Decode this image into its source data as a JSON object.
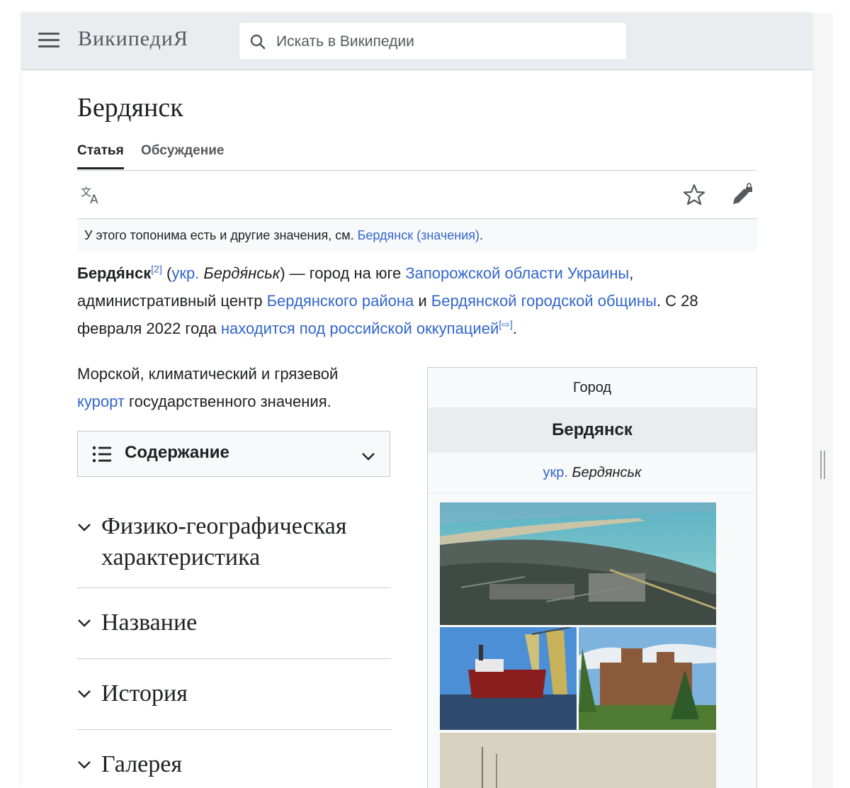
{
  "header": {
    "wordmark": "ВикипедиЯ",
    "search_placeholder": "Искать в Википедии"
  },
  "article": {
    "title": "Бердянск",
    "tabs": [
      {
        "label": "Статья",
        "active": true
      },
      {
        "label": "Обсуждение",
        "active": false
      }
    ],
    "hatnote": {
      "text": "У этого топонима есть и другие значения, см. ",
      "link": "Бердянск (значения)",
      "end": "."
    },
    "lead": {
      "bold": "Бердя́нск",
      "ref1": "[2]",
      "open_paren": " (",
      "lang": "укр.",
      "native": "Бердя́нськ",
      "t1": ") — город на юге ",
      "link1": "Запорожской области Украины",
      "t2": ", административный центр ",
      "link2": "Бердянского района",
      "t3": " и ",
      "link3": "Бердянской городской общины",
      "t4": ". С 28 февраля 2022 года ",
      "link4": "находится под российской оккупацией",
      "ref2": "[⇨]",
      "t5": "."
    },
    "second_para": {
      "t1": "Морской, климатический и грязевой ",
      "link": "курорт",
      "t2": " государственного значения."
    },
    "toc_label": "Содержание",
    "sections": [
      "Физико-географическая характеристика",
      "Название",
      "История",
      "Галерея"
    ]
  },
  "infobox": {
    "type": "Город",
    "name": "Бердянск",
    "lang": "укр.",
    "native": "Бердянськ"
  },
  "colors": {
    "link": "#3366cc",
    "header_bg": "#eaecf0",
    "text": "#202122"
  }
}
